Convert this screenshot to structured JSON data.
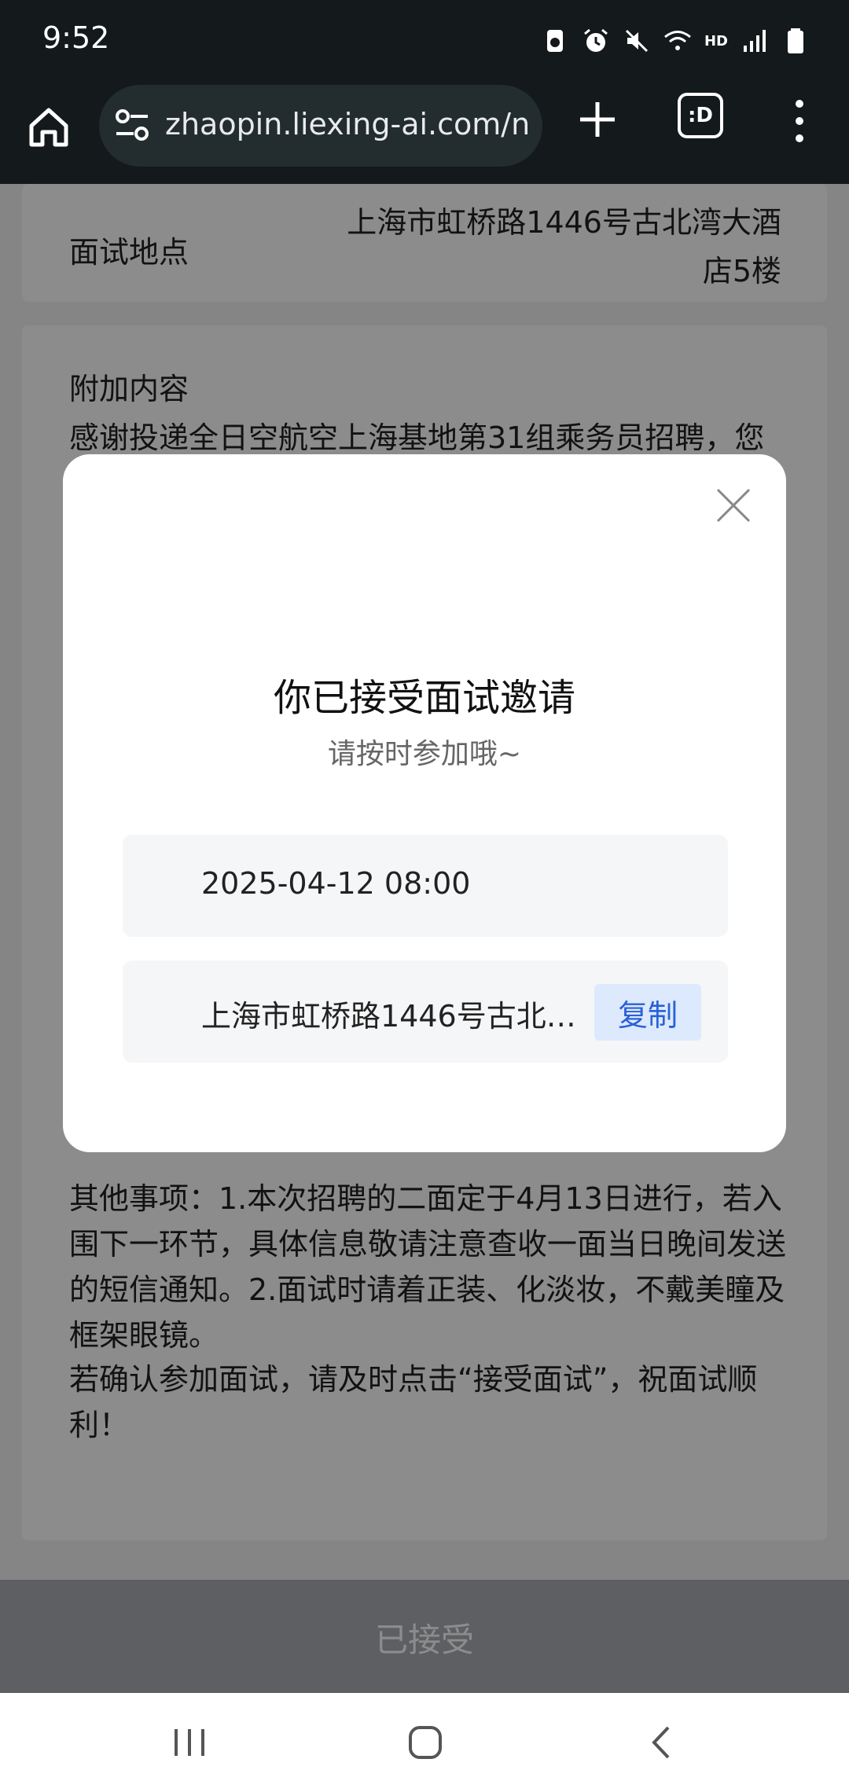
{
  "status_bar": {
    "time": "9:52",
    "icons": [
      "recycle-icon",
      "alarm-icon",
      "mute-icon",
      "wifi-icon",
      "hd-icon",
      "signal-icon",
      "battery-icon"
    ],
    "hd_label": "HD"
  },
  "browser": {
    "url": "zhaopin.liexing-ai.com/n",
    "tabs_label": ":D"
  },
  "page": {
    "location_label": "面试地点",
    "location_value": "上海市虹桥路1446号古北湾大酒店5楼",
    "extra_title": "附加内容",
    "extra_desc": "感谢投递全日空航空上海基地第31组乘务员招聘，您",
    "notes": "其他事项：1.本次招聘的二面定于4月13日进行，若入围下一环节，具体信息敬请注意查收一面当日晚间发送的短信通知。2.面试时请着正装、化淡妆，不戴美瞳及框架眼镜。",
    "confirm": "若确认参加面试，请及时点击“接受面试”，祝面试顺利！",
    "accepted_button": "已接受"
  },
  "modal": {
    "title": "你已接受面试邀请",
    "subtitle": "请按时参加哦~",
    "datetime": "2025-04-12 08:00",
    "address": "上海市虹桥路1446号古北湾大酒店5楼",
    "copy_label": "复制"
  },
  "colors": {
    "status_bg": "#14191b",
    "url_bg": "#232c2e",
    "copy_bg": "#dde9fd",
    "copy_text": "#2a61d6",
    "accepted_bg": "#a9adb3"
  }
}
